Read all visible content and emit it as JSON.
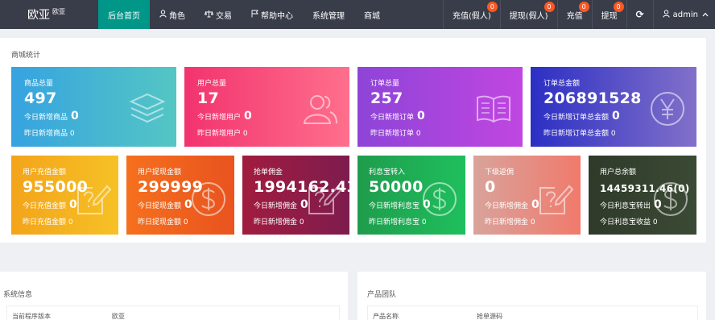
{
  "brand": {
    "main": "欧亚",
    "sub": "欧亚"
  },
  "nav": [
    {
      "label": "后台首页",
      "icon": ""
    },
    {
      "label": "角色",
      "icon": "user-icon"
    },
    {
      "label": "交易",
      "icon": "scale-icon"
    },
    {
      "label": "帮助中心",
      "icon": "flag-icon"
    },
    {
      "label": "系统管理",
      "icon": ""
    },
    {
      "label": "商城",
      "icon": ""
    }
  ],
  "right_nav": [
    {
      "label": "充值(假人)",
      "badge": "0"
    },
    {
      "label": "提现(假人)",
      "badge": "0"
    },
    {
      "label": "充值",
      "badge": "0"
    },
    {
      "label": "提现",
      "badge": "0"
    }
  ],
  "refresh_icon": "⟳",
  "user": {
    "name": "admin"
  },
  "section_title": "商城统计",
  "cards_row1": [
    {
      "title": "商品总量",
      "value": "497",
      "today_label": "今日新增商品",
      "today_value": "0",
      "yesterday": "昨日新增商品 0",
      "icon": "layers-icon",
      "gradient": [
        "#36a3e0",
        "#54c6c4"
      ]
    },
    {
      "title": "用户总量",
      "value": "17",
      "today_label": "今日新增用户",
      "today_value": "0",
      "yesterday": "昨日新增用户 0",
      "icon": "users-icon",
      "gradient": [
        "#f2336f",
        "#ff6f8c"
      ]
    },
    {
      "title": "订单总量",
      "value": "257",
      "today_label": "今日新增订单",
      "today_value": "0",
      "yesterday": "昨日新增订单 0",
      "icon": "book-icon",
      "gradient": [
        "#8e44d8",
        "#c046e0"
      ]
    },
    {
      "title": "订单总金额",
      "value": "206891528",
      "today_label": "今日新增订单总金额",
      "today_value": "0",
      "yesterday": "昨日新增订单总金额 0",
      "icon": "yen-icon",
      "gradient": [
        "#2b2fc4",
        "#8270c9"
      ]
    }
  ],
  "cards_row2": [
    {
      "title": "用户充值金额",
      "value": "955000",
      "today_label": "今日充值金额",
      "today_value": "0",
      "yesterday": "昨日充值金额 0",
      "icon": "edit-icon",
      "gradient": [
        "#f3a41a",
        "#f6c126"
      ],
      "small": false
    },
    {
      "title": "用户提现金额",
      "value": "299999",
      "today_label": "今日提现金额",
      "today_value": "0",
      "yesterday": "昨日提现金额 0",
      "icon": "dollar-icon",
      "gradient": [
        "#f5701e",
        "#e9531f"
      ],
      "small": false
    },
    {
      "title": "抢单佣金",
      "value": "1994162.43",
      "today_label": "今日新增佣金",
      "today_value": "0",
      "yesterday": "昨日新增佣金 0",
      "icon": "edit-icon",
      "gradient": [
        "#a11c3f",
        "#7e1c4e"
      ],
      "small": false
    },
    {
      "title": "利息宝转入",
      "value": "50000",
      "today_label": "今日新增利息宝",
      "today_value": "0",
      "yesterday": "昨日新增利息宝 0",
      "icon": "dollar-icon",
      "gradient": [
        "#1f9c4d",
        "#1fbf5d"
      ],
      "small": false
    },
    {
      "title": "下级返佣",
      "value": "0",
      "today_label": "今日新增佣金",
      "today_value": "0",
      "yesterday": "昨日新增佣金 0",
      "icon": "edit-icon",
      "gradient": [
        "#d9a39b",
        "#f07a6c"
      ],
      "small": false
    },
    {
      "title": "用户总余额",
      "value": "14459311.46(0)",
      "today_label": "今日利息宝转出",
      "today_value": "0",
      "yesterday": "今日利息宝收益 0",
      "icon": "dollar-icon",
      "gradient": [
        "#2f3a2a",
        "#3b4a34"
      ],
      "small": true
    }
  ],
  "system_info": {
    "title": "系统信息",
    "row_key": "当前程序版本",
    "row_value": "欧亚"
  },
  "product_team": {
    "title": "产品团队",
    "row_key": "产品名称",
    "row_value": "抢单源码"
  }
}
